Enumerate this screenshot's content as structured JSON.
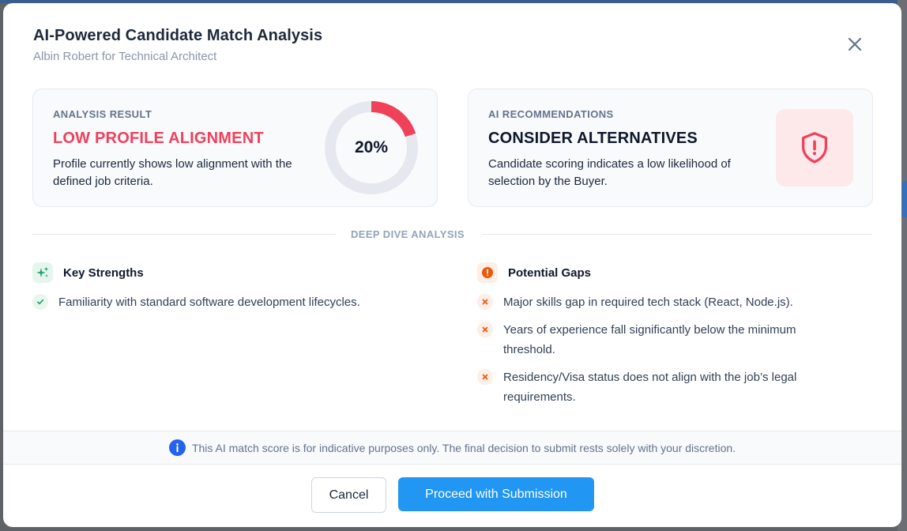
{
  "modal": {
    "title": "AI-Powered Candidate Match Analysis",
    "subtitle": "Albin Robert for Technical Architect",
    "close_icon": "close-icon"
  },
  "analysis": {
    "kicker": "ANALYSIS RESULT",
    "headline": "LOW PROFILE ALIGNMENT",
    "description": "Profile currently shows low alignment with the defined job criteria.",
    "score_label": "20%",
    "score_fraction": 0.2,
    "score_color": "#f0415b",
    "track_color": "#e5e9ef"
  },
  "recommendation": {
    "kicker": "AI RECOMMENDATIONS",
    "headline": "CONSIDER ALTERNATIVES",
    "description": "Candidate scoring indicates a low likelihood of selection by the Buyer.",
    "icon": "shield-alert-icon"
  },
  "deep_dive": {
    "label": "DEEP DIVE ANALYSIS"
  },
  "strengths": {
    "title": "Key Strengths",
    "icon": "sparkles-icon",
    "items": [
      "Familiarity with standard software development lifecycles."
    ]
  },
  "gaps": {
    "title": "Potential Gaps",
    "icon": "alert-circle-icon",
    "items": [
      "Major skills gap in required tech stack (React, Node.js).",
      "Years of experience fall significantly below the minimum threshold.",
      "Residency/Visa status does not align with the job’s legal requirements."
    ]
  },
  "disclaimer": {
    "icon": "info-icon",
    "text": "This AI match score is for indicative purposes only. The final decision to submit rests solely with your discretion."
  },
  "actions": {
    "cancel_label": "Cancel",
    "proceed_label": "Proceed with Submission"
  },
  "colors": {
    "accent": "#2196f3",
    "danger": "#f0415b",
    "success": "#1ea672",
    "warning": "#ea580c"
  }
}
